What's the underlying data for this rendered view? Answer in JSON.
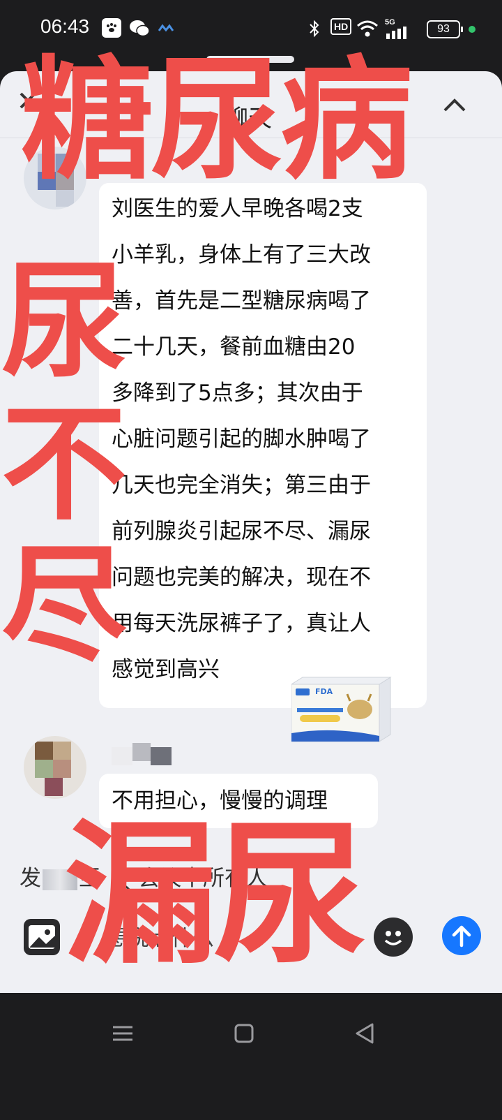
{
  "status_bar": {
    "time": "06:43",
    "battery": "93",
    "signal_label": "5G",
    "hd_label": "HD"
  },
  "header": {
    "title": "聊天"
  },
  "messages": [
    {
      "lines": [
        "刘医生的爱人早晚各喝2支",
        "小羊乳，身体上有了三大改",
        "善，首先是二型糖尿病喝了",
        "二十几天，餐前血糖由20",
        "多降到了5点多；其次由于",
        "心脏问题引起的脚水肿喝了",
        "几天也完全消失；第三由于",
        "前列腺炎引起尿不尽、漏尿",
        "问题也完美的解决，现在不",
        "用每天洗尿裤子了，真让人",
        "感觉到高兴"
      ]
    },
    {
      "text": "不用担心，慢慢的调理"
    }
  ],
  "product_box": {
    "brand_label": "FDA"
  },
  "send_to": {
    "prefix": "发",
    "middle": "至",
    "suffix": "会议中所有人"
  },
  "composer": {
    "placeholder": "想说点什么"
  },
  "overlay": {
    "top": "糖尿病",
    "vertical": [
      "尿",
      "不",
      "尽"
    ],
    "bottom": "漏尿"
  },
  "colors": {
    "overlay_red": "#ee4e4a",
    "send_blue": "#1677ff",
    "sheet_bg": "#eff0f4"
  }
}
